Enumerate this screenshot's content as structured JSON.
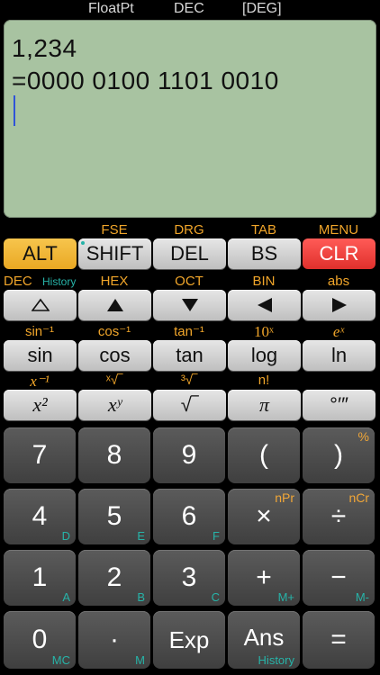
{
  "status": {
    "mode": "FloatPt",
    "base": "DEC",
    "angle": "[DEG]"
  },
  "display": {
    "input": "1,234",
    "result": "=0000 0100 1101 0010"
  },
  "row1_labels": [
    "FSE",
    "DRG",
    "TAB",
    "MENU"
  ],
  "row1_keys": [
    "ALT",
    "SHIFT",
    "DEL",
    "BS",
    "CLR"
  ],
  "row2_labels": {
    "dec": "DEC",
    "history": "History",
    "hex": "HEX",
    "oct": "OCT",
    "bin": "BIN",
    "abs": "abs"
  },
  "row3_labels": [
    "sin⁻¹",
    "cos⁻¹",
    "tan⁻¹",
    "10ˣ",
    "eˣ"
  ],
  "row3_keys": [
    "sin",
    "cos",
    "tan",
    "log",
    "ln"
  ],
  "row4_labels": [
    "x⁻¹",
    "ˣ√‾",
    "³√‾",
    "n!"
  ],
  "row4_keys": [
    "x²",
    "xʸ",
    "√‾",
    "π",
    "°′″"
  ],
  "num_keys": {
    "r1": [
      "7",
      "8",
      "9",
      "(",
      ")"
    ],
    "r1_sup": {
      "close": "%"
    },
    "r2": [
      "4",
      "5",
      "6",
      "×",
      "÷"
    ],
    "r2_sub": [
      "D",
      "E",
      "F"
    ],
    "r2_sup": [
      "nPr",
      "nCr"
    ],
    "r3": [
      "1",
      "2",
      "3",
      "+",
      "−"
    ],
    "r3_sub": [
      "A",
      "B",
      "C",
      "M+",
      "M-"
    ],
    "r4": [
      "0",
      "·",
      "Exp",
      "Ans",
      "="
    ],
    "r4_sub": [
      "MC",
      "M",
      "History"
    ]
  },
  "colors": {
    "display_bg": "#a8c3a1",
    "alt": "#f7c54d",
    "clr": "#e0302c",
    "teal": "#27b3a8",
    "orange": "#f0a52a"
  }
}
